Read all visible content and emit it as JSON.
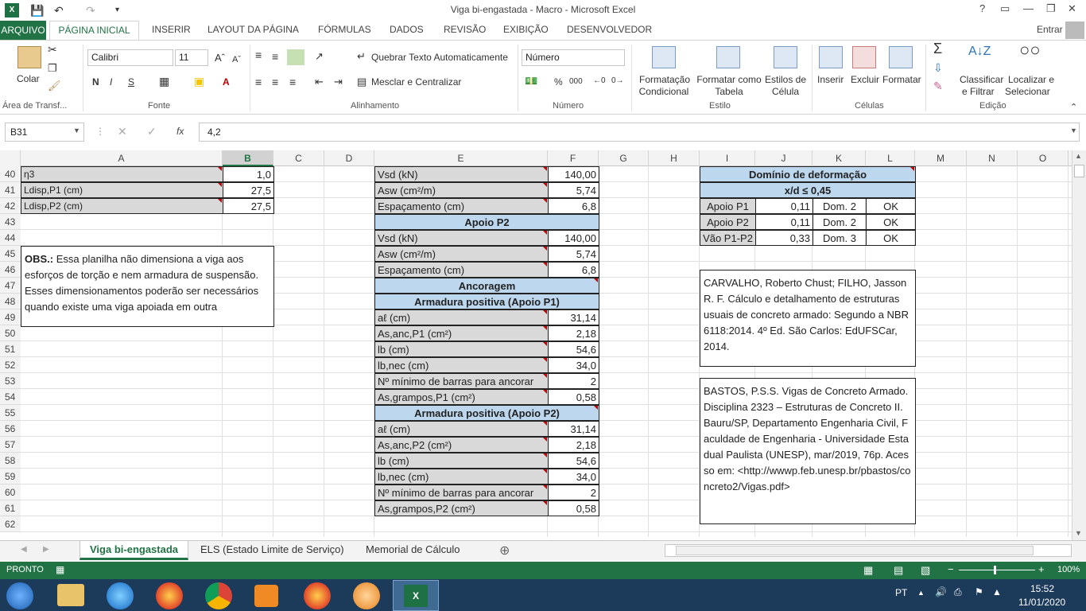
{
  "window": {
    "title": "Viga bi-engastada - Macro - Microsoft Excel",
    "help": "?",
    "user": "Entrar"
  },
  "ribbon_tabs": [
    "ARQUIVO",
    "PÁGINA INICIAL",
    "INSERIR",
    "LAYOUT DA PÁGINA",
    "FÓRMULAS",
    "DADOS",
    "REVISÃO",
    "EXIBIÇÃO",
    "DESENVOLVEDOR"
  ],
  "ribbon": {
    "paste": "Colar",
    "font_name": "Calibri",
    "font_size": "11",
    "bold": "N",
    "italic": "I",
    "underline": "S",
    "wrap_text": "Quebrar Texto Automaticamente",
    "merge_center": "Mesclar e Centralizar",
    "number_format": "Número",
    "percent": "%",
    "thousands": "000",
    "cond_format": [
      "Formatação",
      "Condicional"
    ],
    "format_table": [
      "Formatar como",
      "Tabela"
    ],
    "cell_styles": [
      "Estilos de",
      "Célula"
    ],
    "insert": "Inserir",
    "delete": "Excluir",
    "format": "Formatar",
    "sort_filter": [
      "Classificar",
      "e Filtrar"
    ],
    "find_select": [
      "Localizar e",
      "Selecionar"
    ],
    "groups": [
      "Área de Transf...",
      "Fonte",
      "Alinhamento",
      "Número",
      "Estilo",
      "Células",
      "Edição"
    ]
  },
  "formula_bar": {
    "name_box": "B31",
    "fx": "fx",
    "value": "4,2"
  },
  "columns": [
    "A",
    "B",
    "C",
    "D",
    "E",
    "F",
    "G",
    "H",
    "I",
    "J",
    "K",
    "L",
    "M",
    "N",
    "O"
  ],
  "rows": [
    "40",
    "41",
    "42",
    "43",
    "44",
    "45",
    "46",
    "47",
    "48",
    "49",
    "50",
    "51",
    "52",
    "53",
    "54",
    "55",
    "56",
    "57",
    "58",
    "59",
    "60",
    "61",
    "62"
  ],
  "left_table": [
    {
      "label": "η3",
      "value": "1,0"
    },
    {
      "label": "Ldisp,P1 (cm)",
      "value": "27,5"
    },
    {
      "label": "Ldisp,P2 (cm)",
      "value": "27,5"
    }
  ],
  "obs": {
    "bold": "OBS.:",
    "text": " Essa planilha não dimensiona a viga aos esforços de torção e nem armadura de suspensão. Esses dimensionamentos poderão ser necessários quando existe uma viga apoiada em outra"
  },
  "mid_table": {
    "top_rows": [
      {
        "label": "Vsd (kN)",
        "value": "140,00"
      },
      {
        "label": "Asw (cm²/m)",
        "value": "5,74"
      },
      {
        "label": "Espaçamento (cm)",
        "value": "6,8"
      }
    ],
    "apoio_p2_title": "Apoio P2",
    "apoio_p2_rows": [
      {
        "label": "Vsd (kN)",
        "value": "140,00"
      },
      {
        "label": "Asw (cm²/m)",
        "value": "5,74"
      },
      {
        "label": "Espaçamento (cm)",
        "value": "6,8"
      }
    ],
    "ancoragem_title": "Ancoragem",
    "p1_title": "Armadura positiva (Apoio P1)",
    "p1_rows": [
      {
        "label": "aℓ (cm)",
        "value": "31,14"
      },
      {
        "label": "As,anc,P1 (cm²)",
        "value": "2,18"
      },
      {
        "label": "lb (cm)",
        "value": "54,6"
      },
      {
        "label": "lb,nec (cm)",
        "value": "34,0"
      },
      {
        "label": "Nº mínimo de barras para ancorar",
        "value": "2"
      },
      {
        "label": "As,grampos,P1 (cm²)",
        "value": "0,58"
      }
    ],
    "p2_title": "Armadura positiva (Apoio P2)",
    "p2_rows": [
      {
        "label": "aℓ (cm)",
        "value": "31,14"
      },
      {
        "label": "As,anc,P2 (cm²)",
        "value": "2,18"
      },
      {
        "label": "lb (cm)",
        "value": "54,6"
      },
      {
        "label": "lb,nec (cm)",
        "value": "34,0"
      },
      {
        "label": "Nº mínimo de barras para ancorar",
        "value": "2"
      },
      {
        "label": "As,grampos,P2 (cm²)",
        "value": "0,58"
      }
    ]
  },
  "dominio": {
    "title": "Domínio de deformação",
    "subtitle": "x/d ≤ 0,45",
    "rows": [
      {
        "label": "Apoio P1",
        "value": "0,11",
        "dom": "Dom. 2",
        "status": "OK"
      },
      {
        "label": "Apoio P2",
        "value": "0,11",
        "dom": "Dom. 2",
        "status": "OK"
      },
      {
        "label": "Vão P1-P2",
        "value": "0,33",
        "dom": "Dom. 3",
        "status": "OK"
      }
    ]
  },
  "ref1": "CARVALHO, Roberto Chust; FILHO, Jasson R. F. Cálculo e detalhamento de estruturas usuais de concreto armado: Segundo a NBR 6118:2014. 4º Ed. São Carlos: EdUFSCar, 2014.",
  "ref2": "BASTOS, P.S.S. Vigas de Concreto Armado. Disciplina 2323 – Estruturas de Concreto II. Bauru/SP, Departamento Engenharia Civil, Faculdade de Engenharia - Universidade Estadual Paulista (UNESP), mar/2019, 76p. Acesso em: <http://wwwp.feb.unesp.br/pbastos/concreto2/Vigas.pdf>",
  "sheets": [
    "Viga bi-engastada",
    "ELS (Estado Limite de Serviço)",
    "Memorial de Cálculo"
  ],
  "status": {
    "ready": "PRONTO",
    "zoom": "100%"
  },
  "taskbar": {
    "lang": "PT",
    "time": "15:52",
    "date": "11/01/2020",
    "excel_label": "X"
  },
  "colors": {
    "excel_green": "#217346",
    "header_blue": "#bdd7ee",
    "label_gray": "#d9d9d9"
  }
}
